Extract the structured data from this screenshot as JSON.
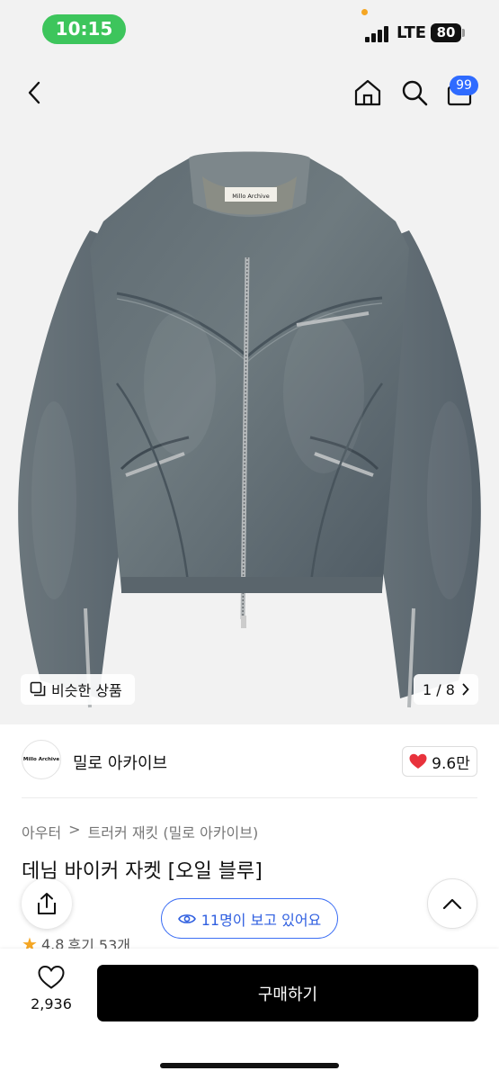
{
  "status_bar": {
    "time": "10:15",
    "network": "LTE",
    "battery": "80"
  },
  "header": {
    "cart_badge": "99",
    "icons": [
      "back-icon",
      "home-icon",
      "search-icon",
      "cart-icon"
    ]
  },
  "gallery": {
    "label_on_garment": "Millo Archive",
    "similar_label": "비슷한 상품",
    "page_indicator": "1 / 8"
  },
  "brand": {
    "logo_text": "Millo Archive",
    "name": "밀로 아카이브",
    "likes": "9.6만"
  },
  "product": {
    "breadcrumb": [
      "아우터",
      "트러커 재킷 (밀로 아카이브)"
    ],
    "breadcrumb_separator": ">",
    "title": "데님 바이커 자켓 [오일 블루]",
    "rating": "4.8",
    "reviews": "후기 53개"
  },
  "floating": {
    "viewers": "11명이 보고 있어요"
  },
  "bottom": {
    "wish_count": "2,936",
    "buy_label": "구매하기"
  },
  "colors": {
    "accent_blue": "#2f6bff",
    "time_green": "#3dc55c",
    "heart_red": "#e8323c",
    "star": "#f5a623"
  }
}
